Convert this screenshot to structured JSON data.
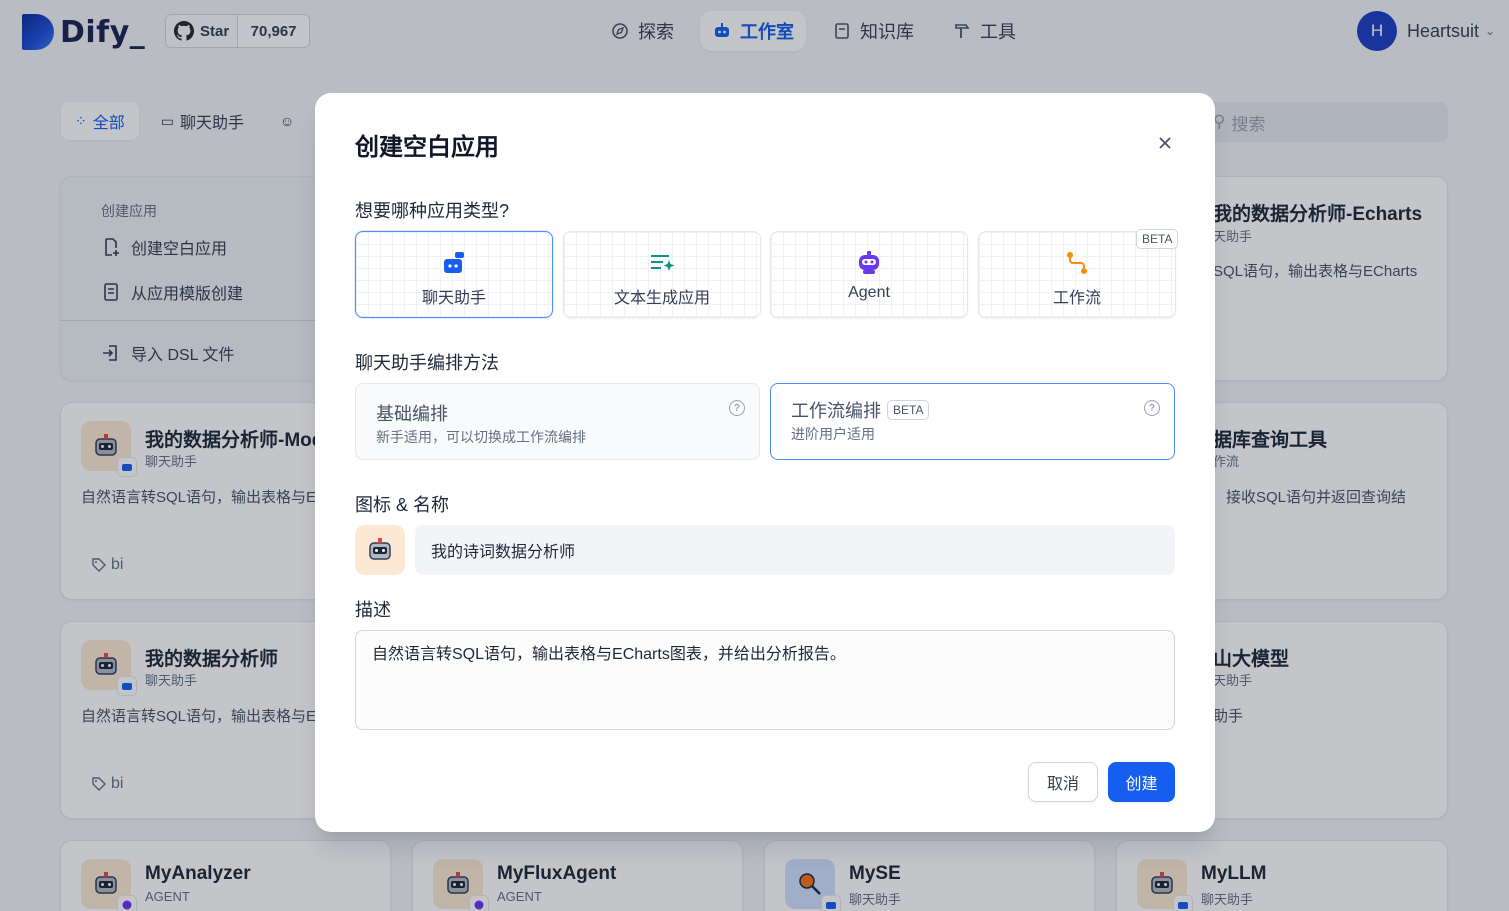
{
  "brand": {
    "name": "Dify_"
  },
  "github": {
    "star_label": "Star",
    "star_count": "70,967"
  },
  "nav": [
    {
      "label": "探索",
      "icon": "compass-icon"
    },
    {
      "label": "工作室",
      "icon": "robot-icon",
      "active": true
    },
    {
      "label": "知识库",
      "icon": "book-icon"
    },
    {
      "label": "工具",
      "icon": "hammer-icon"
    }
  ],
  "user": {
    "initial": "H",
    "name": "Heartsuit"
  },
  "filters": [
    {
      "label": "全部",
      "active": true
    },
    {
      "label": "聊天助手"
    }
  ],
  "search": {
    "placeholder": "搜索"
  },
  "create_card": {
    "section_title": "创建应用",
    "blank": "创建空白应用",
    "template": "从应用模版创建",
    "import": "导入 DSL 文件"
  },
  "apps": [
    {
      "name": "我的数据分析师-Mod",
      "type": "聊天助手",
      "desc": "自然语言转SQL语句，输出表格与EC图表",
      "tag": "bi"
    },
    {
      "name": "我的数据分析师",
      "type": "聊天助手",
      "desc": "自然语言转SQL语句，输出表格与EC图表",
      "tag": "bi"
    },
    {
      "name": "我的数据分析师-Echarts",
      "type": "天助手",
      "desc": "SQL语句，输出表格与ECharts"
    },
    {
      "name": "据库查询工具",
      "type": "作流",
      "desc": "接收SQL语句并返回查询结"
    },
    {
      "name": "山大模型",
      "type": "天助手",
      "desc": "助手"
    },
    {
      "name": "MyAnalyzer",
      "type": "AGENT"
    },
    {
      "name": "MyFluxAgent",
      "type": "AGENT"
    },
    {
      "name": "MySE",
      "type": "聊天助手"
    },
    {
      "name": "MyLLM",
      "type": "聊天助手"
    }
  ],
  "modal": {
    "title": "创建空白应用",
    "type_question": "想要哪种应用类型?",
    "types": [
      {
        "label": "聊天助手",
        "icon": "chat-bot-icon",
        "selected": true
      },
      {
        "label": "文本生成应用",
        "icon": "text-generate-icon"
      },
      {
        "label": "Agent",
        "icon": "agent-icon"
      },
      {
        "label": "工作流",
        "icon": "workflow-icon",
        "badge": "BETA"
      }
    ],
    "method_label": "聊天助手编排方法",
    "methods": [
      {
        "title": "基础编排",
        "sub": "新手适用，可以切换成工作流编排"
      },
      {
        "title": "工作流编排",
        "badge": "BETA",
        "sub": "进阶用户适用",
        "selected": true
      }
    ],
    "name_label": "图标 & 名称",
    "name_value": "我的诗词数据分析师",
    "desc_label": "描述",
    "desc_value": "自然语言转SQL语句，输出表格与ECharts图表，并给出分析报告。",
    "cancel": "取消",
    "create": "创建"
  },
  "colors": {
    "primary": "#155eef",
    "selected_border": "#528bff",
    "workflow_orange": "#f79009",
    "text_gen_green": "#0e9384",
    "agent_purple": "#6938ef"
  }
}
